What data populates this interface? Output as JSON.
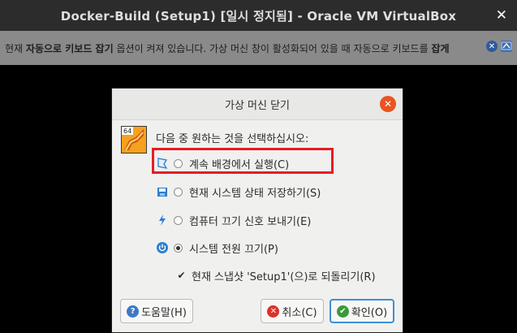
{
  "window": {
    "title": "Docker-Build (Setup1) [일시 정지됨] - Oracle VM VirtualBox",
    "close_glyph": "✕"
  },
  "notice": {
    "pre": "현재 ",
    "bold1": "자동으로 키보드 잡기",
    "mid": " 옵션이 켜져 있습니다. 가상 머신 창이 활성화되어 있을 때 자동으로 키보드를 ",
    "bold2": "잡게"
  },
  "dialog": {
    "title": "가상 머신 닫기",
    "close_glyph": "✕",
    "prompt": "다음 중 원하는 것을 선택하십시오:",
    "logo_badge": "64",
    "options": [
      {
        "label": "계속 배경에서 실행(C)",
        "icon": "background-run-icon",
        "checked": false
      },
      {
        "label": "현재 시스템 상태 저장하기(S)",
        "icon": "save-state-icon",
        "checked": false
      },
      {
        "label": "컴퓨터 끄기 신호 보내기(E)",
        "icon": "shutdown-signal-icon",
        "checked": false
      },
      {
        "label": "시스템 전원 끄기(P)",
        "icon": "power-off-icon",
        "checked": true
      }
    ],
    "restore_snapshot": {
      "label": "현재 스냅샷 'Setup1'(으)로 되돌리기(R)",
      "checked": true
    },
    "buttons": {
      "help": "도움말(H)",
      "cancel": "취소(C)",
      "ok": "확인(O)"
    }
  },
  "colors": {
    "highlight": "#e81b24",
    "accent": "#e95420",
    "focus": "#3f8fd4"
  }
}
